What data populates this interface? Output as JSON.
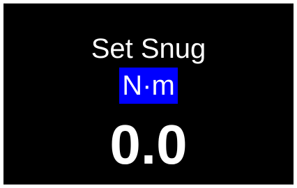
{
  "screen": {
    "title": "Set Snug",
    "unit": "N·m",
    "value": "0.0",
    "background_color": "#000000",
    "unit_highlight_color": "#0000ff",
    "text_color": "#ffffff"
  }
}
